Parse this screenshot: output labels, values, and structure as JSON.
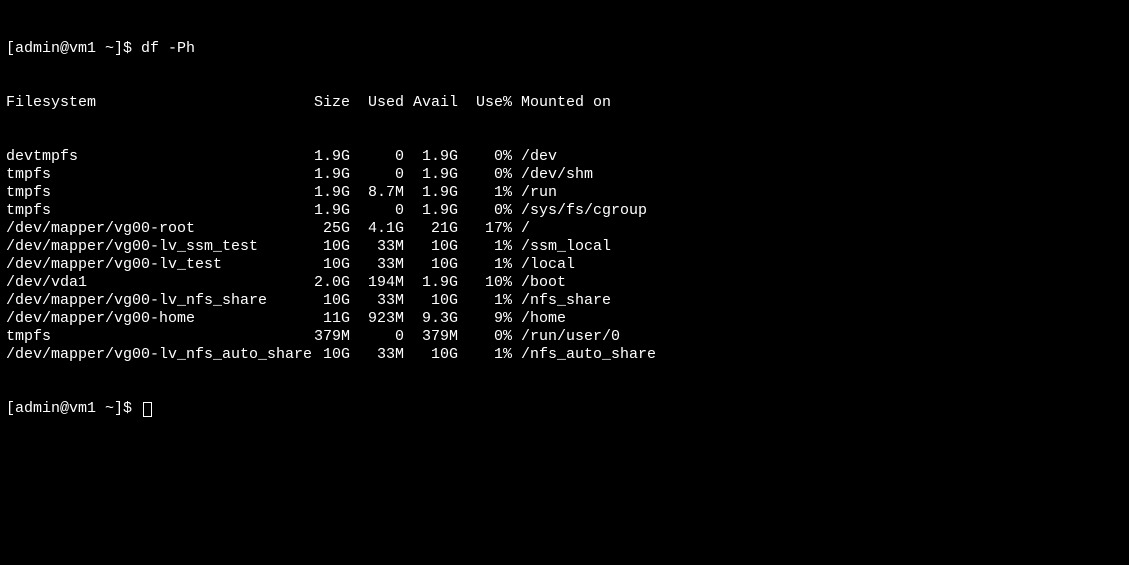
{
  "prompt1": "[admin@vm1 ~]$ ",
  "command": "df -Ph",
  "prompt2": "[admin@vm1 ~]$ ",
  "header": {
    "filesystem": "Filesystem",
    "size": "Size",
    "used": "Used",
    "avail": "Avail",
    "usepct": "Use%",
    "mounted": "Mounted on"
  },
  "rows": [
    {
      "fs": "devtmpfs",
      "size": "1.9G",
      "used": "0",
      "avail": "1.9G",
      "usepct": "0%",
      "mount": "/dev"
    },
    {
      "fs": "tmpfs",
      "size": "1.9G",
      "used": "0",
      "avail": "1.9G",
      "usepct": "0%",
      "mount": "/dev/shm"
    },
    {
      "fs": "tmpfs",
      "size": "1.9G",
      "used": "8.7M",
      "avail": "1.9G",
      "usepct": "1%",
      "mount": "/run"
    },
    {
      "fs": "tmpfs",
      "size": "1.9G",
      "used": "0",
      "avail": "1.9G",
      "usepct": "0%",
      "mount": "/sys/fs/cgroup"
    },
    {
      "fs": "/dev/mapper/vg00-root",
      "size": "25G",
      "used": "4.1G",
      "avail": "21G",
      "usepct": "17%",
      "mount": "/"
    },
    {
      "fs": "/dev/mapper/vg00-lv_ssm_test",
      "size": "10G",
      "used": "33M",
      "avail": "10G",
      "usepct": "1%",
      "mount": "/ssm_local"
    },
    {
      "fs": "/dev/mapper/vg00-lv_test",
      "size": "10G",
      "used": "33M",
      "avail": "10G",
      "usepct": "1%",
      "mount": "/local"
    },
    {
      "fs": "/dev/vda1",
      "size": "2.0G",
      "used": "194M",
      "avail": "1.9G",
      "usepct": "10%",
      "mount": "/boot"
    },
    {
      "fs": "/dev/mapper/vg00-lv_nfs_share",
      "size": "10G",
      "used": "33M",
      "avail": "10G",
      "usepct": "1%",
      "mount": "/nfs_share"
    },
    {
      "fs": "/dev/mapper/vg00-home",
      "size": "11G",
      "used": "923M",
      "avail": "9.3G",
      "usepct": "9%",
      "mount": "/home"
    },
    {
      "fs": "tmpfs",
      "size": "379M",
      "used": "0",
      "avail": "379M",
      "usepct": "0%",
      "mount": "/run/user/0"
    },
    {
      "fs": "/dev/mapper/vg00-lv_nfs_auto_share",
      "size": "10G",
      "used": "33M",
      "avail": "10G",
      "usepct": "1%",
      "mount": "/nfs_auto_share"
    }
  ]
}
